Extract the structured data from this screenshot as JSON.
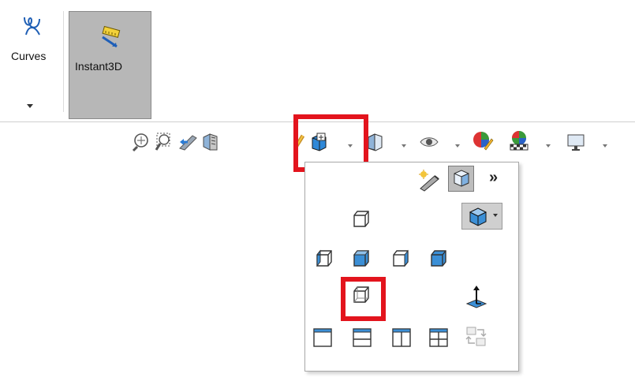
{
  "ribbon": {
    "curves": {
      "label": "Curves",
      "icon": "curves-icon"
    },
    "instant3d": {
      "label": "Instant3D",
      "icon": "instant3d-icon",
      "state": "pressed"
    }
  },
  "heads_up_toolbar": {
    "tools": [
      "zoom-to-fit-icon",
      "zoom-to-area-icon",
      "previous-view-icon",
      "section-view-icon",
      "dynamic-annotation-icon",
      "view-orientation-icon",
      "display-style-icon",
      "hide-show-items-icon",
      "edit-appearance-icon",
      "apply-scene-icon",
      "view-settings-icon"
    ]
  },
  "flyout": {
    "more_label": "»",
    "rows": [
      [
        "new-view-icon",
        "view-selector-icon"
      ],
      [
        "front-view-icon"
      ],
      [
        "left-view-icon",
        "top-view-icon",
        "right-view-icon",
        "trimetric-view-icon"
      ],
      [
        "dimetric-view-icon",
        "normal-to-icon"
      ],
      [
        "single-view-icon",
        "two-view-horizontal-icon",
        "two-view-vertical-icon",
        "four-view-icon",
        "link-views-icon"
      ]
    ],
    "isometric_icon": "isometric-view-icon"
  },
  "colors": {
    "highlight": "#e3141d",
    "pressed_bg": "#b7b7b7",
    "cube_blue": "#3b8fd6"
  }
}
